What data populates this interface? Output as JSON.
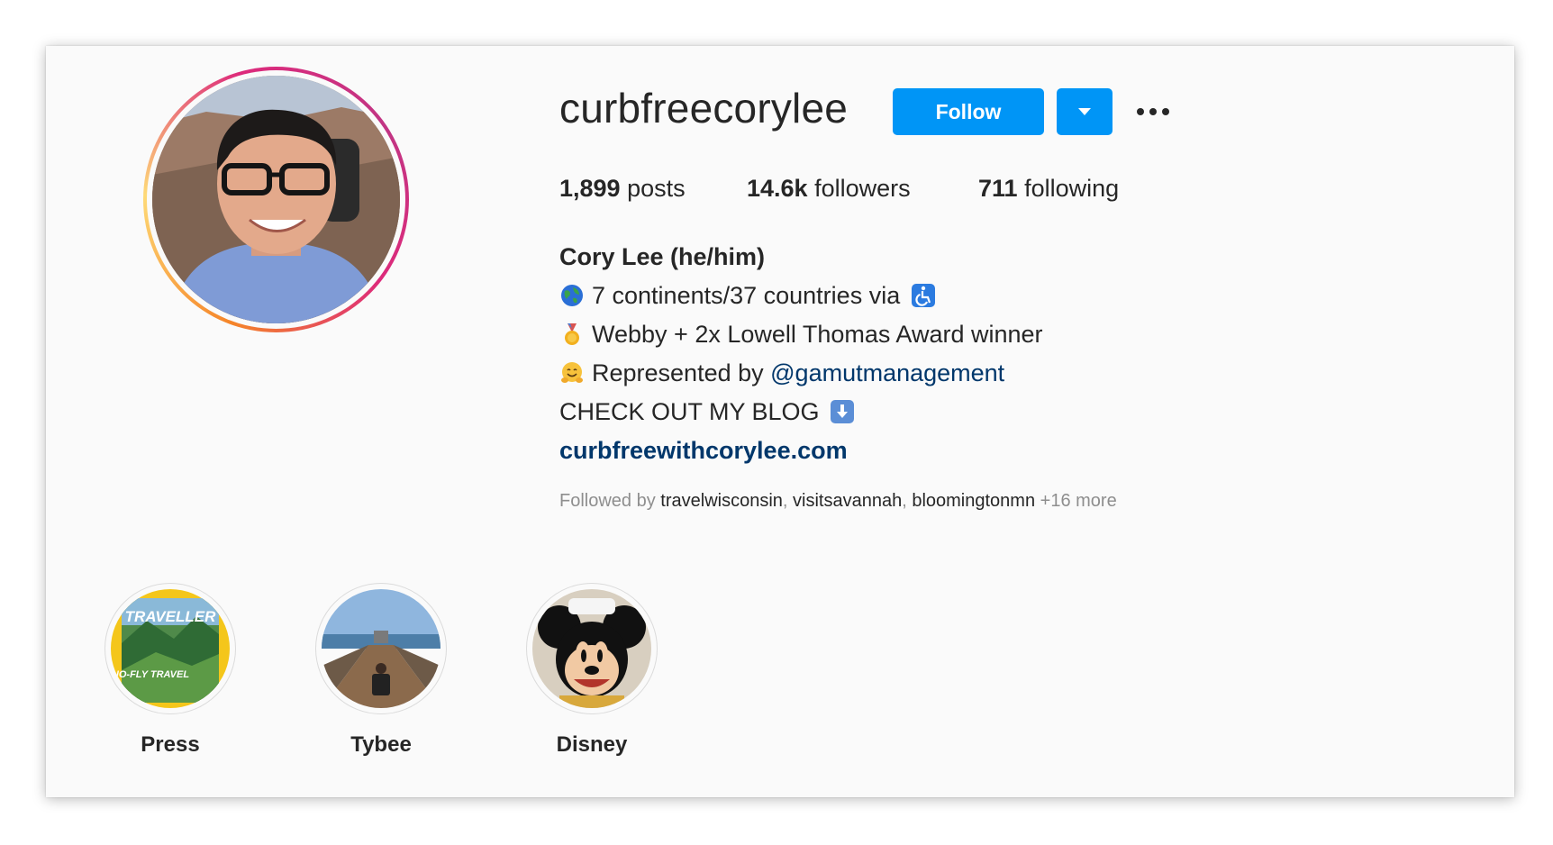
{
  "profile": {
    "username": "curbfreecorylee",
    "follow_label": "Follow"
  },
  "stats": {
    "posts_count": "1,899",
    "posts_label": "posts",
    "followers_count": "14.6k",
    "followers_label": "followers",
    "following_count": "711",
    "following_label": "following"
  },
  "bio": {
    "name": "Cory Lee (he/him)",
    "line1": "7 continents/37 countries via",
    "line2": "Webby + 2x Lowell Thomas Award winner",
    "line3_text": "Represented by",
    "line3_mention": "@gamutmanagement",
    "line4": "CHECK OUT MY BLOG",
    "link": "curbfreewithcorylee.com"
  },
  "followed_by": {
    "prefix": "Followed by",
    "users": [
      "travelwisconsin",
      "visitsavannah",
      "bloomingtonmn"
    ],
    "more": "+16 more"
  },
  "highlights": [
    {
      "label": "Press",
      "cover_text_top": "TRAVELLER",
      "cover_text_bottom": "NO-FLY TRAVEL"
    },
    {
      "label": "Tybee"
    },
    {
      "label": "Disney"
    }
  ],
  "colors": {
    "accent": "#0095f6",
    "link": "#00376b",
    "text": "#262626",
    "muted": "#8e8e8e"
  },
  "icons": [
    "globe-icon",
    "wheelchair-icon",
    "medal-icon",
    "hugging-face-icon",
    "down-arrow-icon",
    "chevron-down-icon",
    "more-icon"
  ]
}
